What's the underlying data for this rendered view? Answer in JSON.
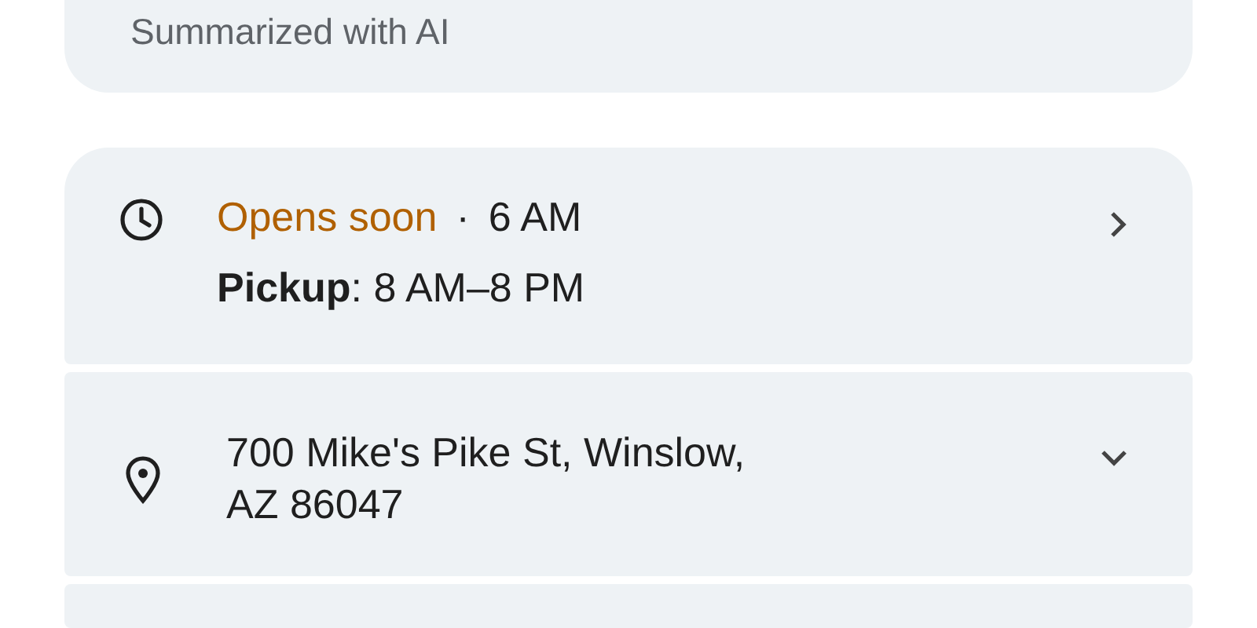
{
  "summary_card": {
    "note": "Summarized with AI"
  },
  "hours": {
    "status": "Opens soon",
    "separator": "·",
    "time": "6 AM",
    "detail": "**Pickup**: 8 AM–8 PM"
  },
  "address": {
    "lines": [
      "700 Mike's Pike St, Winslow,",
      "AZ 86047"
    ],
    "expanded": false
  }
}
